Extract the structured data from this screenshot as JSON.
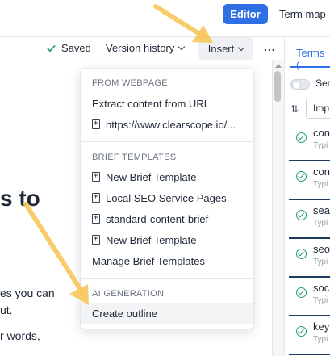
{
  "header": {
    "editor_label": "Editor",
    "termmap_label": "Term map"
  },
  "toolbar": {
    "saved_label": "Saved",
    "version_history_label": "Version history",
    "insert_label": "Insert",
    "more_label": "..."
  },
  "editor": {
    "heading_fragment": "s to",
    "line1": "es you can",
    "line2": "ut.",
    "line3": "r words,"
  },
  "insert_menu": {
    "sections": [
      {
        "header": "FROM WEBPAGE",
        "items": [
          {
            "label": "Extract content from URL",
            "icon": "none"
          },
          {
            "label": "https://www.clearscope.io/...",
            "icon": "add-document-icon"
          }
        ]
      },
      {
        "header": "BRIEF TEMPLATES",
        "items": [
          {
            "label": "New Brief Template",
            "icon": "add-document-icon"
          },
          {
            "label": "Local SEO Service Pages",
            "icon": "add-document-icon"
          },
          {
            "label": "standard-content-brief",
            "icon": "add-document-icon"
          },
          {
            "label": "New Brief Template",
            "icon": "add-document-icon"
          },
          {
            "label": "Manage Brief Templates",
            "icon": "none"
          }
        ]
      },
      {
        "header": "AI GENERATION",
        "items": [
          {
            "label": "Create outline",
            "icon": "none"
          }
        ]
      }
    ]
  },
  "terms_panel": {
    "tab_label": "Terms (",
    "toggle_label": "Sen",
    "sort_label": "Imp",
    "terms": [
      {
        "name": "con",
        "type": "Typi"
      },
      {
        "name": "con",
        "type": "Typi"
      },
      {
        "name": "sea",
        "type": "Typi"
      },
      {
        "name": "seo",
        "type": "Typi"
      },
      {
        "name": "soc",
        "type": "Typi"
      },
      {
        "name": "key",
        "type": "Typi"
      }
    ]
  },
  "colors": {
    "accent": "#2f6fe4",
    "check": "#22a06b",
    "arrow": "#f8c75a"
  }
}
